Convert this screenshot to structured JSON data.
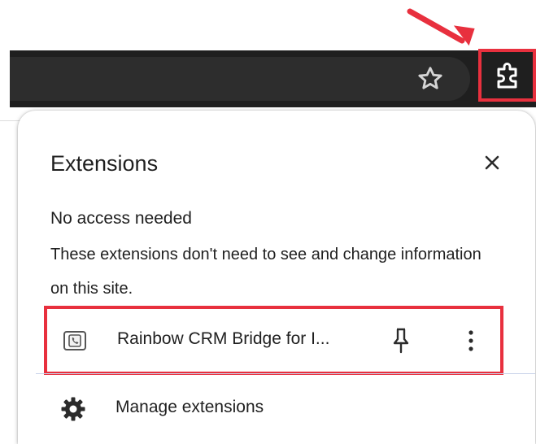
{
  "browser": {
    "bookmark_icon": "star-icon",
    "extensions_icon": "puzzle-piece-icon",
    "highlight_color": "#e8303e"
  },
  "panel": {
    "title": "Extensions",
    "close_icon": "close-icon",
    "section_heading": "No access needed",
    "section_description": "These extensions don't need to see and change information on this site.",
    "extensions": [
      {
        "name": "Rainbow CRM Bridge for I...",
        "icon": "phone-card-icon",
        "pin_icon": "pin-icon",
        "menu_icon": "more-vertical-icon"
      }
    ],
    "manage_label": "Manage extensions",
    "manage_icon": "gear-icon"
  }
}
